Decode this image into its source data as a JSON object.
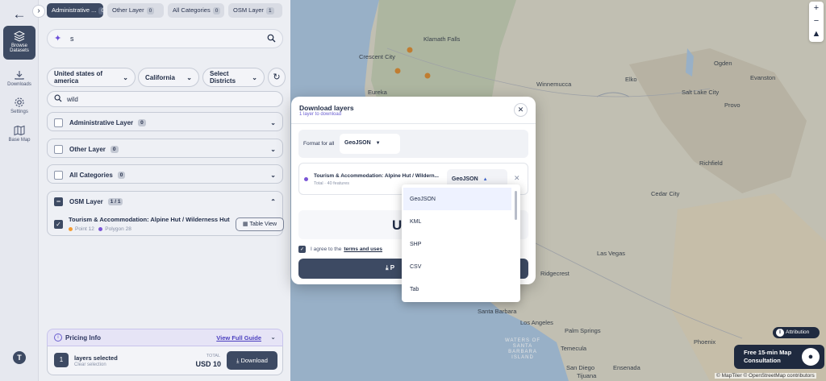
{
  "rail": {
    "items": [
      {
        "label": "Browse Datasets"
      },
      {
        "label": "Downloads"
      },
      {
        "label": "Settings"
      },
      {
        "label": "Base Map"
      }
    ],
    "user_initial": "T"
  },
  "tabs": [
    {
      "label": "Administrative ...",
      "count": "0"
    },
    {
      "label": "Other Layer",
      "count": "0"
    },
    {
      "label": "All Categories",
      "count": "0"
    },
    {
      "label": "OSM Layer",
      "count": "1"
    }
  ],
  "search": {
    "value": "s"
  },
  "filters": {
    "country": "United states of america",
    "state": "California",
    "districts": "Select Districts"
  },
  "layer_filter": {
    "value": "wild"
  },
  "groups": [
    {
      "label": "Administrative Layer",
      "count": "0"
    },
    {
      "label": "Other Layer",
      "count": "0"
    },
    {
      "label": "All Categories",
      "count": "0"
    },
    {
      "label": "OSM Layer",
      "count": "1 / 1"
    }
  ],
  "osm_item": {
    "title": "Tourism & Accommodation: Alpine Hut / Wilderness Hut",
    "point": "Point 12",
    "polygon": "Polygon 28",
    "table_view": "Table View"
  },
  "pricing": {
    "label": "Pricing Info",
    "guide": "View Full Guide"
  },
  "summary": {
    "count": "1",
    "selected": "layers selected",
    "clear": "Clear selection",
    "total_label": "TOTAL",
    "total": "USD 10",
    "download": "Download"
  },
  "map": {
    "places": [
      "Klamath Falls",
      "Crescent City",
      "Eureka",
      "Winnemucca",
      "Elko",
      "Ogden",
      "Evanston",
      "Salt Lake City",
      "Provo",
      "Richfield",
      "Cedar City",
      "Las Vegas",
      "Ridgecrest",
      "Santa Barbara",
      "Los Angeles",
      "Palm Springs",
      "Temecula",
      "San Diego",
      "Phoenix",
      "Tijuana",
      "Ensenada"
    ],
    "sea": "WATERS OF SANTA BARBARA ISLAND",
    "attribution": "Attribution",
    "consult_line1": "Free 15-min Map",
    "consult_line2": "Consultation",
    "credits": "© MapTiler © OpenStreetMap contributors"
  },
  "modal": {
    "title": "Download layers",
    "subtitle": "1 layer to download",
    "format_all_label": "Format for all",
    "format_all_value": "GeoJSON",
    "layer_name": "Tourism & Accommodation: Alpine Hut / Wildern...",
    "layer_features": "Total · 40 features",
    "layer_format": "GeoJSON",
    "price": "US",
    "agree_text": "I agree to the",
    "terms": "terms and uses",
    "proceed": "P"
  },
  "dropdown": {
    "options": [
      "GeoJSON",
      "KML",
      "SHP",
      "CSV",
      "Tab"
    ]
  },
  "colors": {
    "primary": "#3d4a63",
    "accent": "#6b5fd0",
    "point": "#f39c34",
    "polygon": "#7a55d6"
  }
}
